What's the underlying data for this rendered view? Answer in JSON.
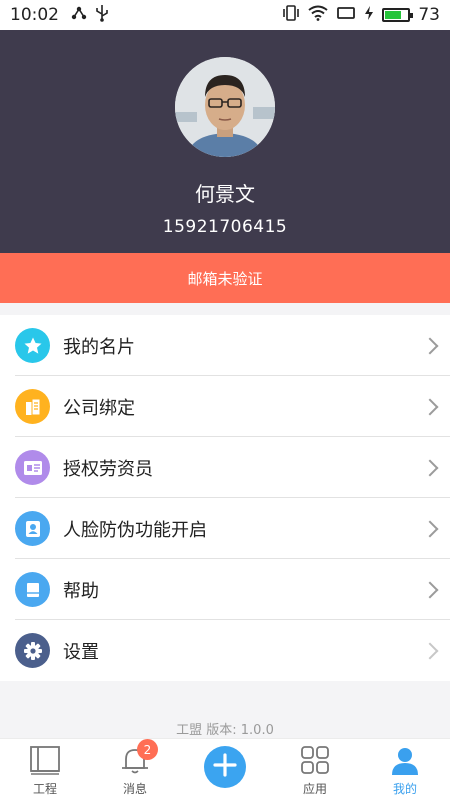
{
  "status_bar": {
    "time": "10:02",
    "battery": "73",
    "battery_level": 0.73,
    "icons": [
      "share-icon",
      "usb-icon",
      "vibrate-icon",
      "wifi-icon",
      "cast-icon",
      "charging-icon",
      "battery-icon"
    ]
  },
  "profile": {
    "name": "何景文",
    "phone": "15921706415",
    "email_notice": "邮箱未验证"
  },
  "menu": [
    {
      "label": "我的名片",
      "icon": "star-icon",
      "color": "#29c7ea"
    },
    {
      "label": "公司绑定",
      "icon": "company-icon",
      "color": "#ffb21f"
    },
    {
      "label": "授权劳资员",
      "icon": "id-card-icon",
      "color": "#b08bea"
    },
    {
      "label": "人脸防伪功能开启",
      "icon": "face-id-icon",
      "color": "#4aa8f0"
    },
    {
      "label": "帮助",
      "icon": "book-icon",
      "color": "#4aa8f0"
    },
    {
      "label": "设置",
      "icon": "gear-icon",
      "color": "#4b5f8c"
    }
  ],
  "version": "工盟 版本: 1.0.0",
  "tabs": {
    "project": "工程",
    "messages": "消息",
    "messages_badge": "2",
    "apps": "应用",
    "mine": "我的"
  },
  "colors": {
    "header_bg": "#3f3b4d",
    "banner_bg": "#ff6e55",
    "accent": "#3ba4f0"
  }
}
